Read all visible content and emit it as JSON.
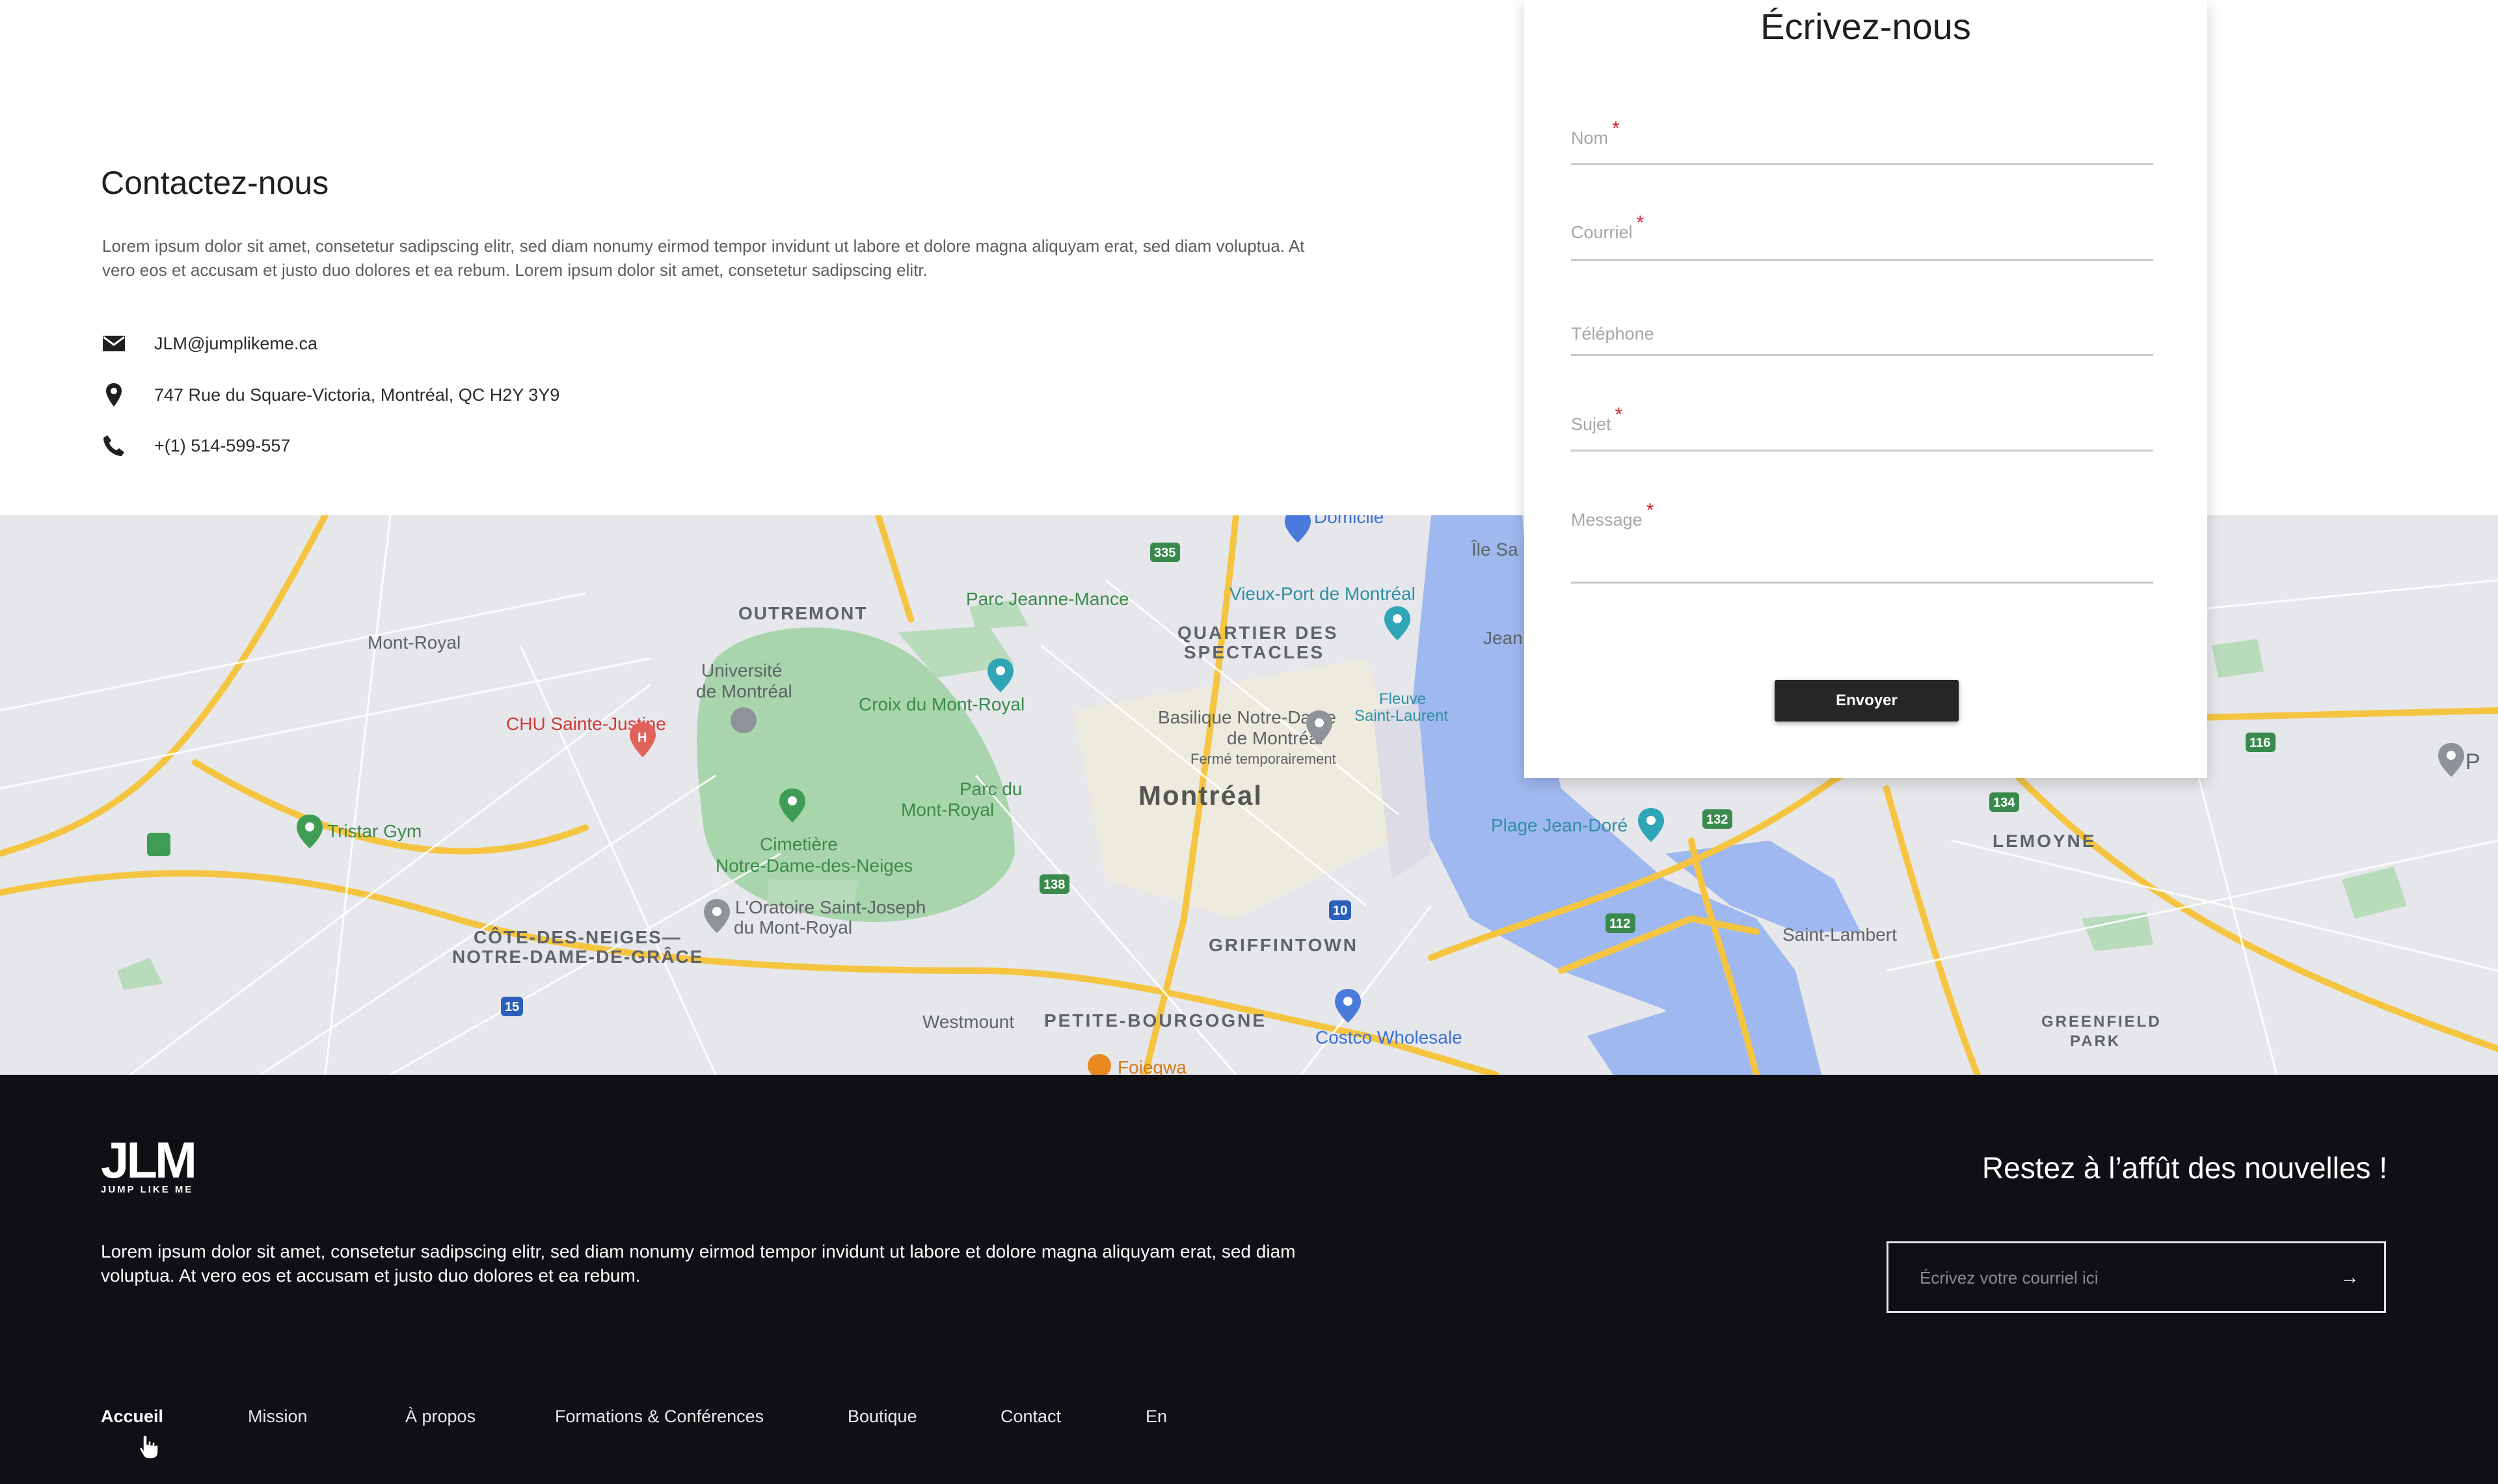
{
  "contact": {
    "title": "Contactez-nous",
    "description": "Lorem ipsum dolor sit amet, consetetur sadipscing elitr, sed diam nonumy eirmod tempor invidunt ut labore et dolore magna aliquyam erat, sed diam voluptua. At vero eos et accusam et justo duo dolores et ea rebum.  Lorem ipsum dolor sit amet, consetetur sadipscing elitr.",
    "email": {
      "icon": "envelope-icon",
      "text": "JLM@jumplikeme.ca"
    },
    "address": {
      "icon": "map-pin-icon",
      "text": "747 Rue du Square-Victoria, Montréal, QC H2Y 3Y9"
    },
    "phone": {
      "icon": "phone-icon",
      "text": "+(1) 514-599-557"
    }
  },
  "form": {
    "title": "Écrivez-nous",
    "fields": {
      "name": {
        "label": "Nom",
        "required_mark": "*"
      },
      "email": {
        "label": "Courriel",
        "required_mark": "*"
      },
      "phone": {
        "label": "Téléphone"
      },
      "subject": {
        "label": "Sujet",
        "required_mark": "*"
      },
      "message": {
        "label": "Message",
        "required_mark": "*"
      }
    },
    "submit_label": "Envoyer"
  },
  "map": {
    "labels": {
      "outremont": "OUTREMONT",
      "parc_jeanne_mance": "Parc Jeanne-Mance",
      "vieux_port": "Vieux-Port de Montréal",
      "quartier1": "QUARTIER DES",
      "quartier2": "SPECTACLES",
      "mont_royal": "Mont-Royal",
      "universite1": "Université",
      "universite2": "de Montréal",
      "croix": "Croix du Mont-Royal",
      "basilique1": "Basilique Notre-Dame",
      "basilique2": "de Montréal",
      "basilique3": "Fermé temporairement",
      "fleuve1": "Fleuve",
      "fleuve2": "Saint-Laurent",
      "chu": "CHU Sainte-Justine",
      "parc_du1": "Parc du",
      "parc_du2": "Mont-Royal",
      "montreal": "Montréal",
      "plage": "Plage Jean-Doré",
      "lemoyne": "LEMOYNE",
      "tristar": "Tristar Gym",
      "cimetiere1": "Cimetière",
      "cimetiere2": "Notre-Dame-des-Neiges",
      "oratoire1": "L'Oratoire Saint-Joseph",
      "oratoire2": "du Mont-Royal",
      "cdn1": "CÔTE-DES-NEIGES—",
      "cdn2": "NOTRE-DAME-DE-GRÂCE",
      "griffintown": "GRIFFINTOWN",
      "saint_lambert": "Saint-Lambert",
      "westmount": "Westmount",
      "petite_bourgogne": "PETITE-BOURGOGNE",
      "costco": "Costco Wholesale",
      "greenfield1": "GREENFIELD",
      "greenfield2": "PARK",
      "domicile": "Domicile",
      "ile": "Île Sa",
      "jean": "Jean",
      "foiegwa": "Foiegwa",
      "p": "P"
    },
    "route_shields": [
      "335",
      "138",
      "10",
      "132",
      "134",
      "112",
      "116",
      "15"
    ]
  },
  "footer": {
    "logo_big": "JLM",
    "logo_small": "JUMP LIKE ME",
    "description": "Lorem ipsum dolor sit amet, consetetur sadipscing elitr, sed diam nonumy eirmod tempor invidunt ut labore et dolore magna aliquyam erat, sed diam voluptua. At vero eos et accusam et justo duo dolores et ea rebum.",
    "newsletter_title": "Restez à l’affût des nouvelles !",
    "newsletter_placeholder": "Écrivez votre courriel ici",
    "newsletter_arrow": "→",
    "nav": {
      "accueil": "Accueil",
      "mission": "Mission",
      "apropos": "À propos",
      "formations": "Formations & Conférences",
      "boutique": "Boutique",
      "contact": "Contact",
      "lang": "En"
    },
    "active_nav": "Accueil"
  }
}
